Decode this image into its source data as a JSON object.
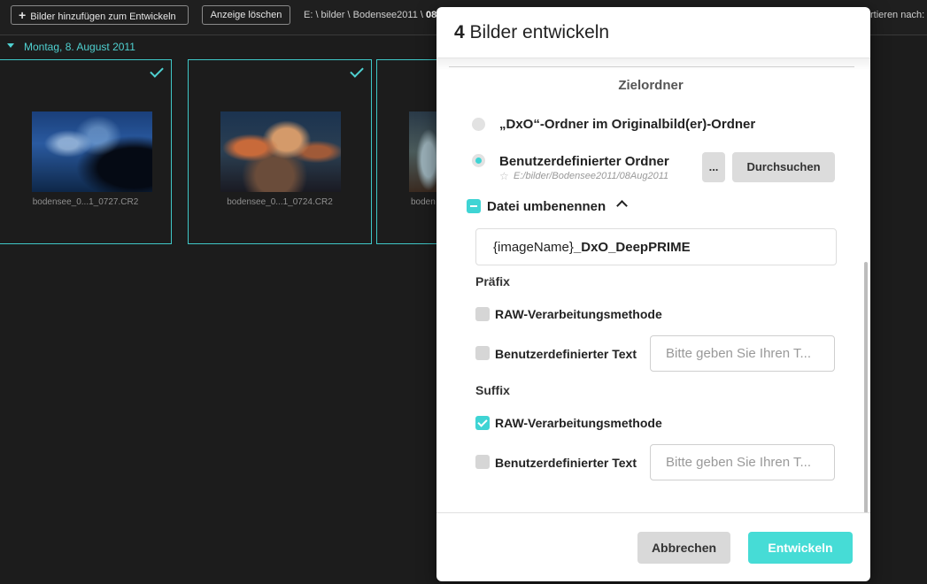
{
  "toolbar": {
    "add_label": "Bilder hinzufügen zum Entwickeln",
    "clear_label": "Anzeige löschen",
    "path_prefix": "E: \\ bilder \\ Bodensee2011 \\",
    "path_current": "08A",
    "sort_label": "rtieren nach:"
  },
  "browser": {
    "date_header": "Montag, 8. August 2011",
    "thumbnails": [
      {
        "filename": "bodensee_0...1_0727.CR2",
        "checked": true
      },
      {
        "filename": "bodensee_0...1_0724.CR2",
        "checked": true
      },
      {
        "filename": "boden",
        "checked": false
      }
    ]
  },
  "dialog": {
    "title_count": "4",
    "title_text": "Bilder entwickeln",
    "section_title": "Zielordner",
    "option_dxo": "„DxO“-Ordner im Originalbild(er)-Ordner",
    "option_custom": "Benutzerdefinierter Ordner",
    "custom_path": "E:/bilder/Bodensee2011/08Aug2011",
    "ellipsis_label": "...",
    "browse_label": "Durchsuchen",
    "rename_label": "Datei umbenennen",
    "name_pattern_token": "{imageName}",
    "name_pattern_suffix": "_DxO_DeepPRIME",
    "prefix_title": "Präfix",
    "prefix_raw_label": "RAW-Verarbeitungsmethode",
    "prefix_custom_label": "Benutzerdefinierter Text",
    "prefix_custom_placeholder": "Bitte geben Sie Ihren T...",
    "suffix_title": "Suffix",
    "suffix_raw_label": "RAW-Verarbeitungsmethode",
    "suffix_custom_label": "Benutzerdefinierter Text",
    "suffix_custom_placeholder": "Bitte geben Sie Ihren T...",
    "cancel_label": "Abbrechen",
    "develop_label": "Entwickeln"
  },
  "colors": {
    "accent": "#3fd4d4",
    "background": "#1c1c1c"
  }
}
